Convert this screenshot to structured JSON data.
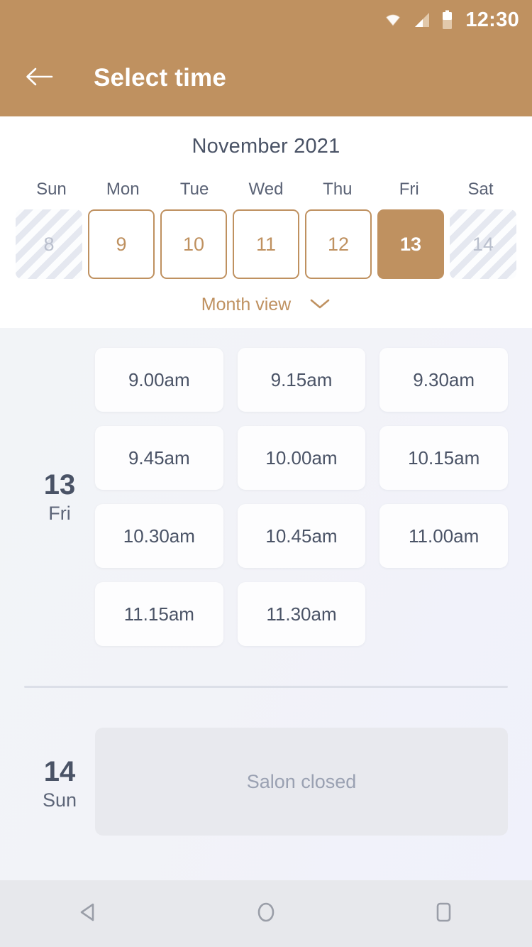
{
  "colors": {
    "brand_tan": "#BF9160",
    "text_slate": "#4A5366",
    "text_muted": "#9AA1B2",
    "disabled_day": "#B9BFCD",
    "body_bg": "#F1F2F8",
    "closed_box": "#E8E9EE",
    "nav_bg": "#E7E8EC"
  },
  "statusbar": {
    "time": "12:30",
    "icons": [
      "wifi-icon",
      "cellular-signal-icon",
      "battery-icon"
    ]
  },
  "appbar": {
    "back_icon": "arrow-left-icon",
    "title": "Select time"
  },
  "calendar": {
    "month_label": "November 2021",
    "weekdays": [
      "Sun",
      "Mon",
      "Tue",
      "Wed",
      "Thu",
      "Fri",
      "Sat"
    ],
    "days": [
      {
        "num": "8",
        "state": "unavailable"
      },
      {
        "num": "9",
        "state": "available"
      },
      {
        "num": "10",
        "state": "available"
      },
      {
        "num": "11",
        "state": "available"
      },
      {
        "num": "12",
        "state": "available"
      },
      {
        "num": "13",
        "state": "selected"
      },
      {
        "num": "14",
        "state": "unavailable"
      }
    ],
    "view_toggle": {
      "label": "Month view",
      "icon": "chevron-down-icon"
    }
  },
  "schedule": [
    {
      "day_number": "13",
      "weekday": "Fri",
      "slots": [
        "9.00am",
        "9.15am",
        "9.30am",
        "9.45am",
        "10.00am",
        "10.15am",
        "10.30am",
        "10.45am",
        "11.00am",
        "11.15am",
        "11.30am"
      ]
    },
    {
      "day_number": "14",
      "weekday": "Sun",
      "closed_message": "Salon closed"
    }
  ],
  "navbar": {
    "back": "triangle-back-icon",
    "home": "circle-home-icon",
    "recents": "square-recents-icon"
  }
}
